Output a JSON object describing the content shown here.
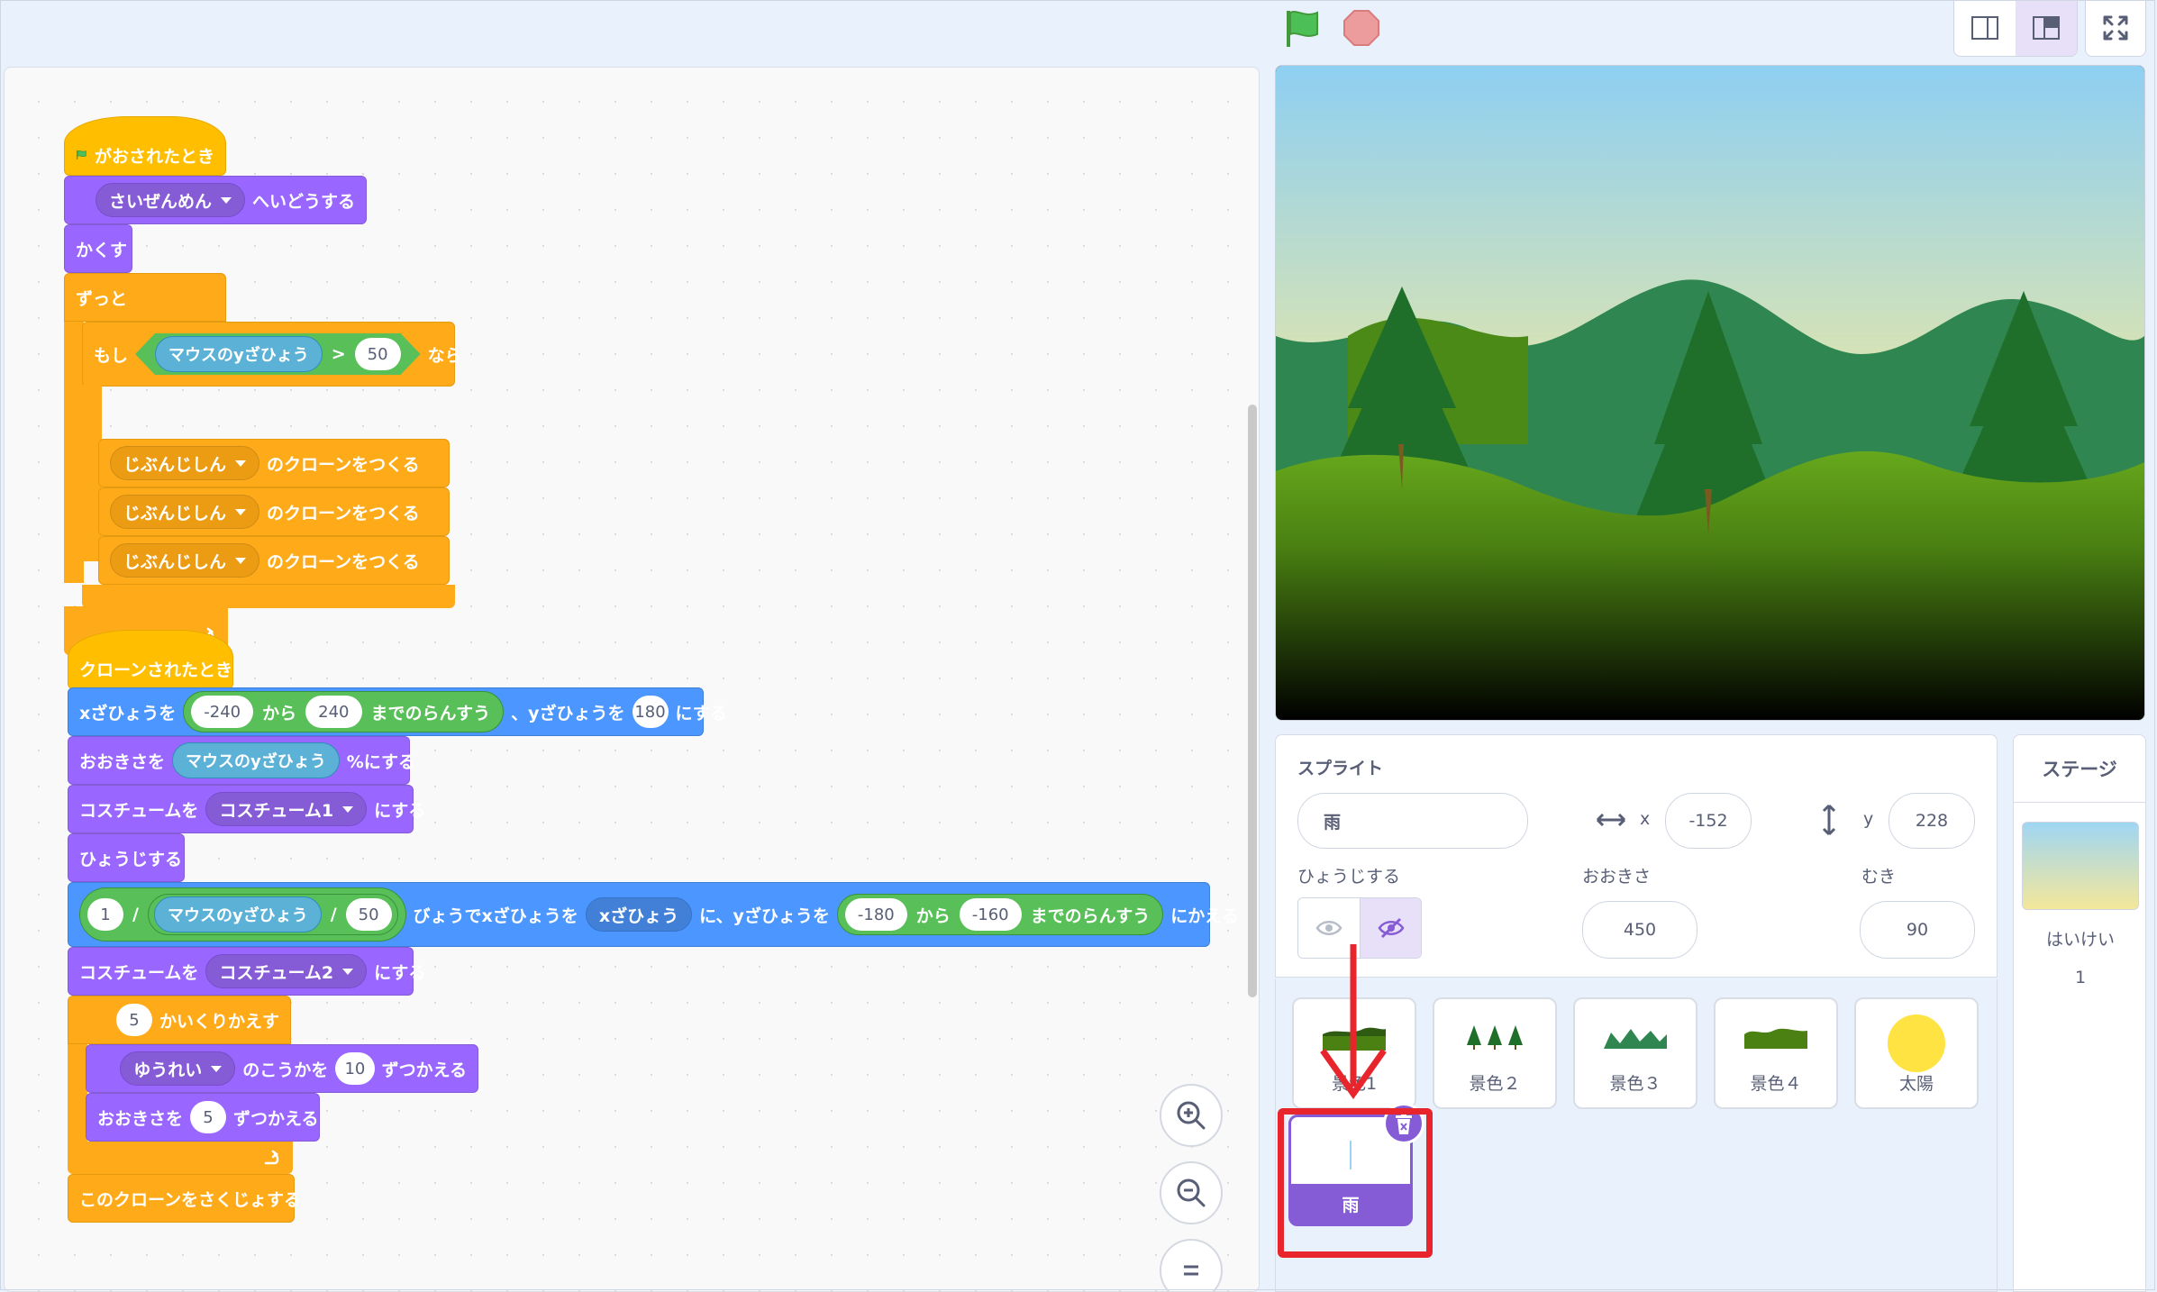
{
  "blocks": {
    "flag_hat": "がおされたとき",
    "goto_layer": {
      "menu": "さいぜんめん",
      "text": "へいどうする"
    },
    "hide": "かくす",
    "forever": "ずっと",
    "if_block": {
      "if": "もし",
      "sensing": "マウスのyざひょう",
      "op": ">",
      "value": "50",
      "then": "なら"
    },
    "clone_blocks": [
      {
        "menu": "じぶんじしん",
        "text": "のクローンをつくる"
      },
      {
        "menu": "じぶんじしん",
        "text": "のクローンをつくる"
      },
      {
        "menu": "じぶんじしん",
        "text": "のクローンをつくる"
      }
    ],
    "clone_hat": "クローンされたとき",
    "goto_xy": {
      "p1": "xざひょうを",
      "from": "-240",
      "kara": "から",
      "to": "240",
      "rand": "までのらんすう",
      "p2": "、yざひょうを",
      "y": "180",
      "suru": "にする"
    },
    "set_size": {
      "p1": "おおきさを",
      "sensing": "マウスのyざひょう",
      "p2": "%にする"
    },
    "switch_costume1": {
      "p1": "コスチュームを",
      "menu": "コスチューム1",
      "p2": "にする"
    },
    "show": "ひょうじする",
    "glide": {
      "one": "1",
      "div1": "/",
      "sensing": "マウスのyざひょう",
      "div2": "/",
      "fifty": "50",
      "p1": "びょうでxざひょうを",
      "xpos": "xざひょう",
      "p2": "に、yざひょうを",
      "from": "-180",
      "kara": "から",
      "to": "-160",
      "rand": "までのらんすう",
      "p3": "にかえる"
    },
    "switch_costume2": {
      "p1": "コスチュームを",
      "menu": "コスチューム2",
      "p2": "にする"
    },
    "repeat": {
      "count": "5",
      "text": "かいくりかえす"
    },
    "change_effect": {
      "menu": "ゆうれい",
      "p1": "のこうかを",
      "value": "10",
      "p2": "ずつかえる"
    },
    "change_size": {
      "p1": "おおきさを",
      "value": "5",
      "p2": "ずつかえる"
    },
    "delete_clone": "このクローンをさくじょする"
  },
  "sprite_info": {
    "sprite_label": "スプライト",
    "sprite_name": "雨",
    "x_label": "x",
    "x_value": "-152",
    "y_label": "y",
    "y_value": "228",
    "show_label": "ひょうじする",
    "size_label": "おおきさ",
    "size_value": "450",
    "direction_label": "むき",
    "direction_value": "90"
  },
  "sprites": [
    {
      "name": "景色1",
      "icon": "landscape-1"
    },
    {
      "name": "景色２",
      "icon": "trees"
    },
    {
      "name": "景色３",
      "icon": "mountains"
    },
    {
      "name": "景色４",
      "icon": "hills"
    },
    {
      "name": "太陽",
      "icon": "sun"
    }
  ],
  "selected_sprite": {
    "name": "雨"
  },
  "stage_panel": {
    "title": "ステージ",
    "backdrop_label": "はいけい",
    "backdrop_count": "1"
  },
  "colors": {
    "events": "#ffbf00",
    "control": "#ffab19",
    "looks": "#9966ff",
    "motion": "#4c97ff",
    "operators": "#59c059",
    "sensing": "#5cb1d6",
    "highlight": "#e8252c",
    "selected": "#855cd6"
  }
}
